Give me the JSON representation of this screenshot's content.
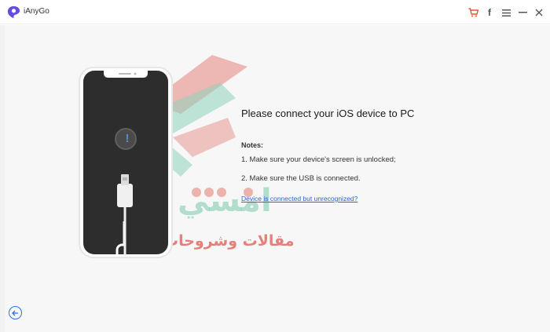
{
  "app": {
    "title": "iAnyGo"
  },
  "titlebar": {
    "icons": [
      "cart-icon",
      "facebook-icon",
      "menu-icon",
      "minimize-icon",
      "close-icon"
    ],
    "facebook_glyph": "f"
  },
  "main": {
    "heading": "Please connect your iOS device to PC",
    "notes_title": "Notes:",
    "notes": [
      "1. Make sure your device's screen is unlocked;",
      "2. Make sure the USB is connected."
    ],
    "link": "Device is connected but unrecognized?"
  },
  "phone": {
    "alert_glyph": "!"
  },
  "watermark": {
    "text_top": "امسي",
    "text_bottom": "مقالات وشروحات"
  },
  "colors": {
    "accent": "#2f6fe4",
    "cart": "#e8542f",
    "link": "#2b63d9",
    "phone_body": "#2e2d2d"
  }
}
